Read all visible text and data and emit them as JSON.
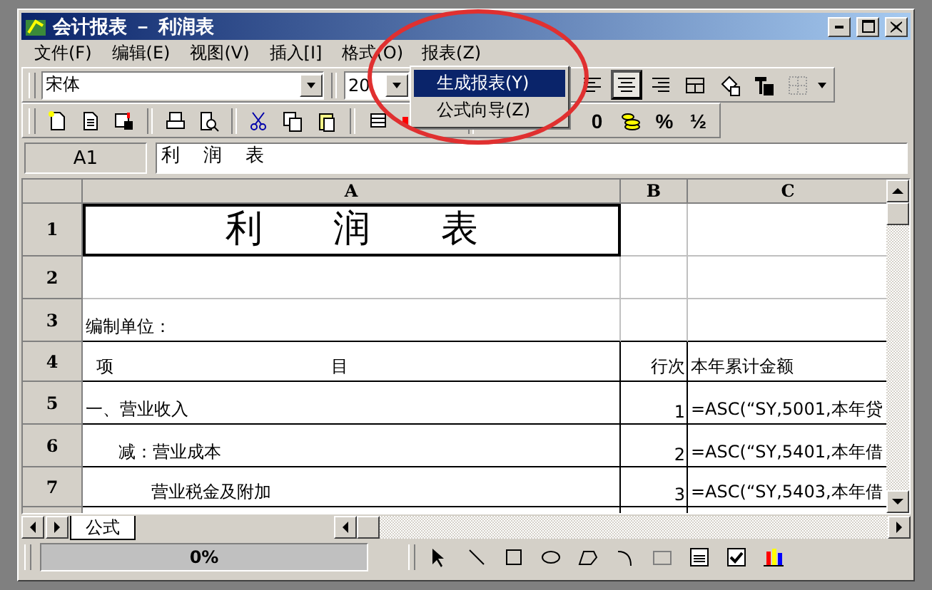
{
  "window": {
    "title": "会计报表 － 利润表"
  },
  "menu": [
    {
      "label": "文件(F)",
      "selected": false
    },
    {
      "label": "编辑(E)",
      "selected": false
    },
    {
      "label": "视图(V)",
      "selected": false
    },
    {
      "label": "插入[I]",
      "selected": false
    },
    {
      "label": "格式(O)",
      "selected": false
    },
    {
      "label": "报表(Z)",
      "selected": true
    }
  ],
  "dropdown": [
    {
      "label": "生成报表(Y)",
      "selected": true
    },
    {
      "label": "公式向导(Z)",
      "selected": false
    }
  ],
  "font": {
    "name": "宋体",
    "size": "20"
  },
  "format_buttons": [
    {
      "label": "0"
    },
    {
      "label": "%"
    },
    {
      "label": "½"
    }
  ],
  "name_box": "A1",
  "formula": "利    润    表",
  "columns": [
    "A",
    "B",
    "C"
  ],
  "rows": [
    {
      "header": "1",
      "kind": "title",
      "cells": [
        "利      润      表",
        "",
        ""
      ]
    },
    {
      "header": "2",
      "kind": "blank",
      "cells": [
        "",
        "",
        ""
      ]
    },
    {
      "header": "3",
      "kind": "caption",
      "cells": [
        "编制单位：",
        "",
        ""
      ]
    },
    {
      "header": "4",
      "kind": "table",
      "cells": [
        "  项                                        目",
        "行次",
        "本年累计金额"
      ]
    },
    {
      "header": "5",
      "kind": "table",
      "cells": [
        "一、营业收入",
        "1",
        "=ASC(“SY,5001,本年贷"
      ]
    },
    {
      "header": "6",
      "kind": "table",
      "cells": [
        "      减：营业成本",
        "2",
        "=ASC(“SY,5401,本年借"
      ]
    },
    {
      "header": "7",
      "kind": "table",
      "cells": [
        "            营业税金及附加",
        "3",
        "=ASC(“SY,5403,本年借"
      ]
    }
  ],
  "sheet_tabs": [
    {
      "label": "公式",
      "selected": true
    }
  ],
  "progress": {
    "text": "0%",
    "level": 0
  }
}
